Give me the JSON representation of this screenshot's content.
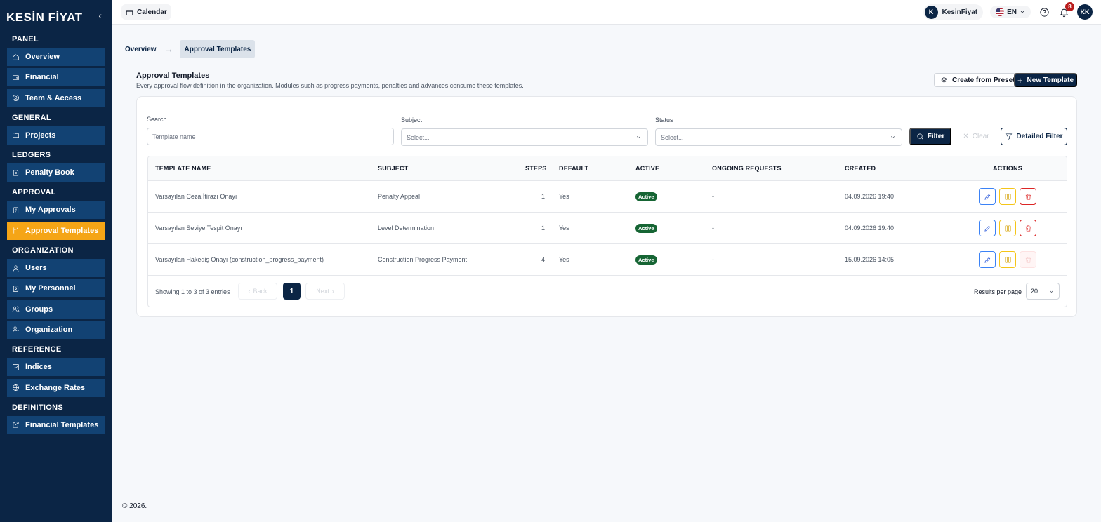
{
  "brand": {
    "logo": "KESİN FİYAT"
  },
  "sidebar": {
    "sections": [
      {
        "title": "PANEL",
        "items": [
          {
            "label": "Overview",
            "icon": "home-icon"
          },
          {
            "label": "Financial",
            "icon": "wallet-icon"
          },
          {
            "label": "Team & Access",
            "icon": "user-circle-icon"
          }
        ]
      },
      {
        "title": "GENERAL",
        "items": [
          {
            "label": "Projects",
            "icon": "folder-icon"
          }
        ]
      },
      {
        "title": "LEDGERS",
        "items": [
          {
            "label": "Penalty Book",
            "icon": "book-icon"
          }
        ]
      },
      {
        "title": "APPROVAL",
        "items": [
          {
            "label": "My Approvals",
            "icon": "clipboard-icon"
          },
          {
            "label": "Approval Templates",
            "icon": "git-branch-icon",
            "active": true
          }
        ]
      },
      {
        "title": "ORGANIZATION",
        "items": [
          {
            "label": "Users",
            "icon": "user-icon"
          },
          {
            "label": "My Personnel",
            "icon": "clipboard-user-icon"
          },
          {
            "label": "Groups",
            "icon": "users-icon"
          },
          {
            "label": "Organization",
            "icon": "org-icon"
          }
        ]
      },
      {
        "title": "REFERENCE",
        "items": [
          {
            "label": "Indices",
            "icon": "chart-icon"
          },
          {
            "label": "Exchange Rates",
            "icon": "globe-icon"
          }
        ]
      },
      {
        "title": "DEFINITIONS",
        "items": [
          {
            "label": "Financial Templates",
            "icon": "external-edit-icon"
          }
        ]
      }
    ]
  },
  "topbar": {
    "calendar_label": "Calendar",
    "org_initial": "K",
    "org_name": "KesinFiyat",
    "language": "EN",
    "notification_count": "8",
    "user_initials": "KK"
  },
  "breadcrumb": {
    "home": "Overview",
    "current": "Approval Templates"
  },
  "page": {
    "title": "Approval Templates",
    "description": "Every approval flow definition in the organization. Modules such as progress payments, penalties and advances consume these templates.",
    "create_preset_label": "Create from Preset",
    "new_template_label": "New Template"
  },
  "filters": {
    "search_label": "Search",
    "search_placeholder": "Template name",
    "subject_label": "Subject",
    "subject_value": "Select...",
    "status_label": "Status",
    "status_value": "Select...",
    "filter_button": "Filter",
    "clear_button": "Clear",
    "detailed_button": "Detailed Filter"
  },
  "table": {
    "columns": [
      "TEMPLATE NAME",
      "SUBJECT",
      "STEPS",
      "DEFAULT",
      "ACTIVE",
      "ONGOING REQUESTS",
      "CREATED",
      "ACTIONS"
    ],
    "rows": [
      {
        "name": "Varsayılan Ceza İtirazı Onayı",
        "subject": "Penalty Appeal",
        "steps": "1",
        "default": "Yes",
        "active": "Active",
        "ongoing": "-",
        "created": "04.09.2026 19:40",
        "delete_enabled": true
      },
      {
        "name": "Varsayılan Seviye Tespit Onayı",
        "subject": "Level Determination",
        "steps": "1",
        "default": "Yes",
        "active": "Active",
        "ongoing": "-",
        "created": "04.09.2026 19:40",
        "delete_enabled": true
      },
      {
        "name": "Varsayılan Hakediş Onayı (construction_progress_payment)",
        "subject": "Construction Progress Payment",
        "steps": "4",
        "default": "Yes",
        "active": "Active",
        "ongoing": "-",
        "created": "15.09.2026 14:05",
        "delete_enabled": false
      }
    ]
  },
  "pagination": {
    "showing": "Showing 1 to 3 of 3 entries",
    "back": "Back",
    "page": "1",
    "next": "Next",
    "per_page_label": "Results per page",
    "per_page_value": "20"
  },
  "footer": {
    "copyright": "© 2026."
  },
  "colors": {
    "sidebar_bg": "#0b2545",
    "nav_item_bg": "#124273",
    "active_accent": "#f5a516",
    "success": "#166534",
    "danger": "#dc2626"
  }
}
